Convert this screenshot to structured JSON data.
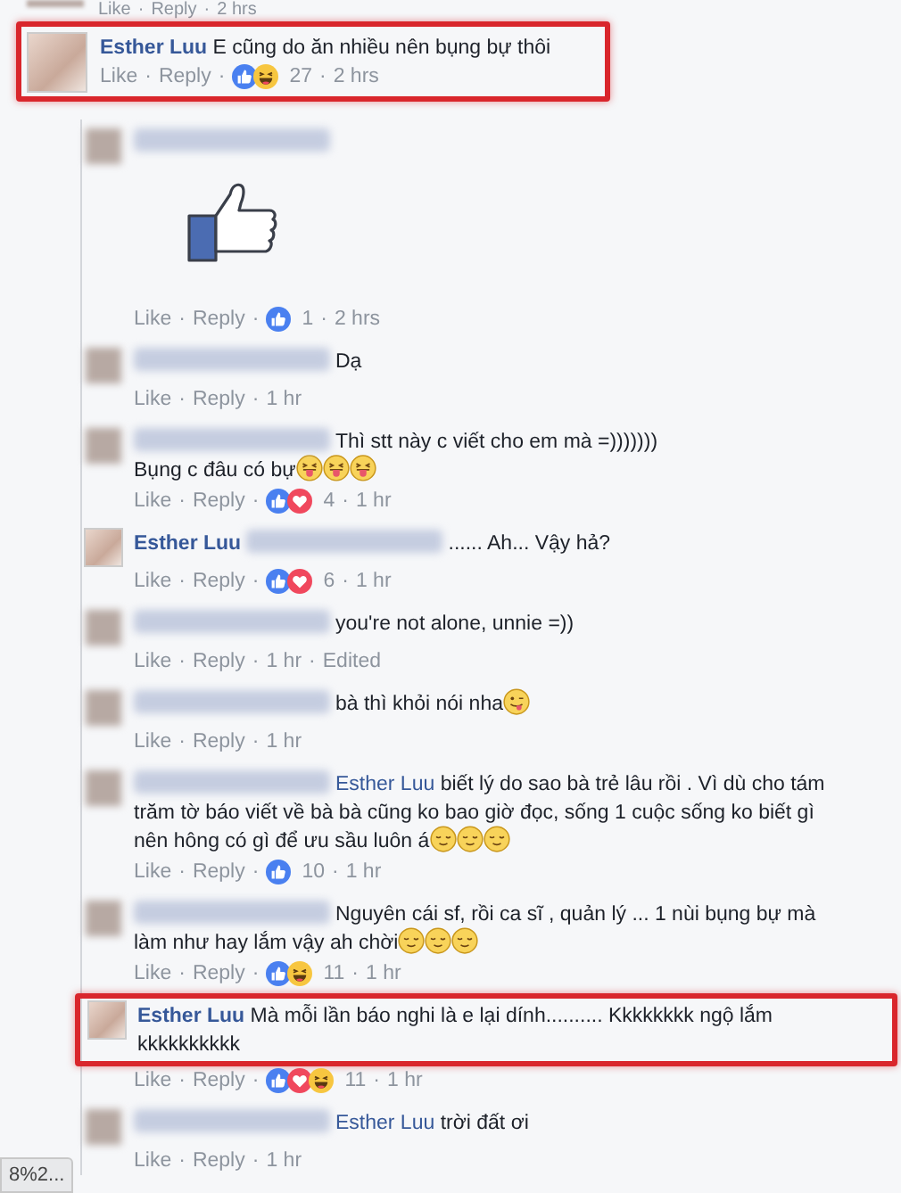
{
  "separator": "·",
  "previous_comment": {
    "like": "Like",
    "reply": "Reply",
    "time": "2 hrs"
  },
  "comment": {
    "author": "Esther Luu",
    "highlighted": true,
    "text": "E cũng do ăn nhiều nên bụng bự thôi",
    "like": "Like",
    "reply": "Reply",
    "reactions": [
      {
        "kind": "like"
      },
      {
        "kind": "haha"
      }
    ],
    "count": "27",
    "time": "2 hrs"
  },
  "replies": [
    {
      "attachment": {
        "kind": "thumbs-up-sticker"
      },
      "like": "Like",
      "reply": "Reply",
      "reactions": [
        {
          "kind": "like"
        }
      ],
      "count": "1",
      "time": "2 hrs",
      "highlighted": false
    },
    {
      "text": "Dạ",
      "like": "Like",
      "reply": "Reply",
      "time": "1 hr",
      "highlighted": false
    },
    {
      "text": "Thì stt này c viết cho em mà =)))))))\nBụng c đâu có bự",
      "emojis": [
        {
          "kind": "tongue-out"
        },
        {
          "kind": "tongue-out"
        },
        {
          "kind": "tongue-out"
        }
      ],
      "like": "Like",
      "reply": "Reply",
      "reactions": [
        {
          "kind": "like"
        },
        {
          "kind": "love"
        }
      ],
      "count": "4",
      "time": "1 hr",
      "highlighted": false
    },
    {
      "author": "Esther Luu",
      "mention_hidden": true,
      "text": "...... Ah... Vậy hả?",
      "like": "Like",
      "reply": "Reply",
      "reactions": [
        {
          "kind": "like"
        },
        {
          "kind": "love"
        }
      ],
      "count": "6",
      "time": "1 hr",
      "highlighted": false
    },
    {
      "text": "you're not alone, unnie =))",
      "like": "Like",
      "reply": "Reply",
      "time": "1 hr",
      "edited": "Edited",
      "highlighted": false
    },
    {
      "text": "bà thì khỏi nói nha",
      "emojis": [
        {
          "kind": "wink-tongue"
        }
      ],
      "like": "Like",
      "reply": "Reply",
      "time": "1 hr",
      "highlighted": false
    },
    {
      "mention": "Esther Luu",
      "text": "biết lý do sao bà trẻ lâu rồi . Vì dù cho tám trăm tờ báo viết về bà bà cũng ko bao giờ đọc, sống 1 cuộc sống ko biết gì nên hông có gì để ưu sầu luôn á",
      "emojis": [
        {
          "kind": "relieved"
        },
        {
          "kind": "relieved"
        },
        {
          "kind": "relieved"
        }
      ],
      "like": "Like",
      "reply": "Reply",
      "reactions": [
        {
          "kind": "like"
        }
      ],
      "count": "10",
      "time": "1 hr",
      "highlighted": false
    },
    {
      "text": "Nguyên cái sf, rồi ca sĩ , quản lý ... 1 nùi bụng bự mà làm như hay lắm vậy ah chời",
      "emojis": [
        {
          "kind": "relieved"
        },
        {
          "kind": "relieved"
        },
        {
          "kind": "relieved"
        }
      ],
      "like": "Like",
      "reply": "Reply",
      "reactions": [
        {
          "kind": "like"
        },
        {
          "kind": "haha"
        }
      ],
      "count": "11",
      "time": "1 hr",
      "highlighted": false
    },
    {
      "author": "Esther Luu",
      "text": "Mà mỗi lần báo nghi là e lại dính.......... Kkkkkkkk ngộ lắm kkkkkkkkkk",
      "like": "Like",
      "reply": "Reply",
      "reactions": [
        {
          "kind": "like"
        },
        {
          "kind": "love"
        },
        {
          "kind": "haha"
        }
      ],
      "count": "11",
      "time": "1 hr",
      "highlighted": true
    },
    {
      "mention": "Esther Luu",
      "text": "trời đất ơi",
      "like": "Like",
      "reply": "Reply",
      "time": "1 hr",
      "highlighted": false
    }
  ],
  "status_url": "8%2..."
}
